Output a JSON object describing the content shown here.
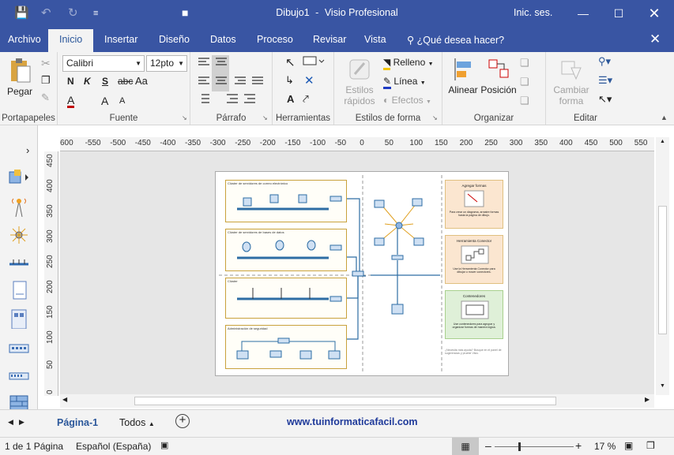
{
  "titlebar": {
    "doc_name": "Dibujo1",
    "separator": "-",
    "app_name": "Visio Profesional",
    "signin": "Inic. ses."
  },
  "tabs": {
    "file": "Archivo",
    "home": "Inicio",
    "insert": "Insertar",
    "design": "Diseño",
    "data": "Datos",
    "process": "Proceso",
    "review": "Revisar",
    "view": "Vista",
    "tellme": "¿Qué desea hacer?"
  },
  "ribbon": {
    "clipboard": {
      "label": "Portapapeles",
      "paste": "Pegar"
    },
    "font": {
      "label": "Fuente",
      "family": "Calibri",
      "size": "12pto",
      "bold": "N",
      "italic": "K",
      "underline": "S",
      "strike": "abc",
      "case": "Aa",
      "grow": "A",
      "shrink": "A",
      "color": "A",
      "accent_color": "#c00000"
    },
    "paragraph": {
      "label": "Párrafo"
    },
    "tools": {
      "label": "Herramientas",
      "text_tool": "A"
    },
    "shape_styles": {
      "label": "Estilos de forma",
      "quick_styles_1": "Estilos",
      "quick_styles_2": "rápidos",
      "fill": "Relleno",
      "line": "Línea",
      "effects": "Efectos"
    },
    "arrange": {
      "label": "Organizar",
      "align": "Alinear",
      "position": "Posición"
    },
    "edit": {
      "label": "Editar",
      "change_shape_1": "Cambiar",
      "change_shape_2": "forma"
    }
  },
  "ruler": {
    "top": [
      "600",
      "-550",
      "-500",
      "-450",
      "-400",
      "-350",
      "-300",
      "-250",
      "-200",
      "-150",
      "-100",
      "-50",
      "0",
      "50",
      "100",
      "150",
      "200",
      "250",
      "300",
      "350",
      "400",
      "450",
      "500",
      "550"
    ],
    "left": [
      "450",
      "400",
      "350",
      "300",
      "250",
      "200",
      "150",
      "100",
      "50",
      "0"
    ]
  },
  "diagram": {
    "c1": "Clúster de servidores de correo electrónico",
    "c2": "Clúster de servidores de bases de datos",
    "c3": "Clúster",
    "c4": "Administración de seguridad",
    "card1_title": "Agregar formas",
    "card1_text": "Para crear un diagrama, arrastre formas hasta la página de dibujo.",
    "card2_title": "Herramienta Conector",
    "card2_text": "Use la Herramienta Conector para dibujar o mover conectores.",
    "card3_title": "Contenedores",
    "card3_text": "Use contenedores para agrupar y organizar formas de manera lógica.",
    "hint": "¿Necesita más ayuda? Busque en el panel de sugerencias y pruebe Visio."
  },
  "pagebar": {
    "page_tab": "Página-1",
    "all": "Todos",
    "watermark": "www.tuinformaticafacil.com",
    "accent": "#1f3a9a"
  },
  "status": {
    "page_info": "1 de 1 Página",
    "language": "Español (España)",
    "zoom": "17 %",
    "zoom_level": 0.3
  },
  "colors": {
    "titlebar": "#3955a3",
    "cluster_border": "#c9a23c"
  }
}
